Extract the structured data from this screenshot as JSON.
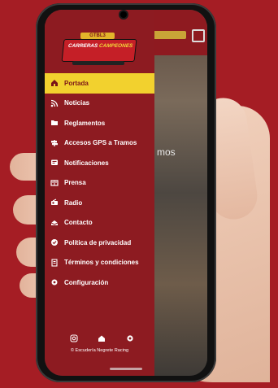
{
  "app": {
    "bg_partial_text": "mos",
    "logo": {
      "line1": "GTBL3",
      "line2": "CARRERAS",
      "line3": "CAMPEONES"
    }
  },
  "menu": {
    "items": [
      {
        "label": "Portada",
        "icon": "home-icon",
        "active": true
      },
      {
        "label": "Noticias",
        "icon": "rss-icon"
      },
      {
        "label": "Reglamentos",
        "icon": "folder-icon"
      },
      {
        "label": "Accesos GPS a Tramos",
        "icon": "signpost-icon"
      },
      {
        "label": "Notificaciones",
        "icon": "notification-icon"
      },
      {
        "label": "Prensa",
        "icon": "newspaper-icon"
      },
      {
        "label": "Radio",
        "icon": "radio-icon"
      },
      {
        "label": "Contacto",
        "icon": "contact-icon"
      },
      {
        "label": "Política de privacidad",
        "icon": "shield-icon"
      },
      {
        "label": "Términos y condiciones",
        "icon": "document-icon"
      },
      {
        "label": "Configuración",
        "icon": "gear-icon"
      }
    ]
  },
  "footer": {
    "credit": "© Escudería Negrete Racing",
    "icons": [
      "instagram-icon",
      "home-icon",
      "settings-icon"
    ]
  },
  "colors": {
    "background": "#a51d24",
    "drawer": "#8d1b21",
    "active_item": "#f2d12e",
    "active_text": "#7a1418"
  }
}
